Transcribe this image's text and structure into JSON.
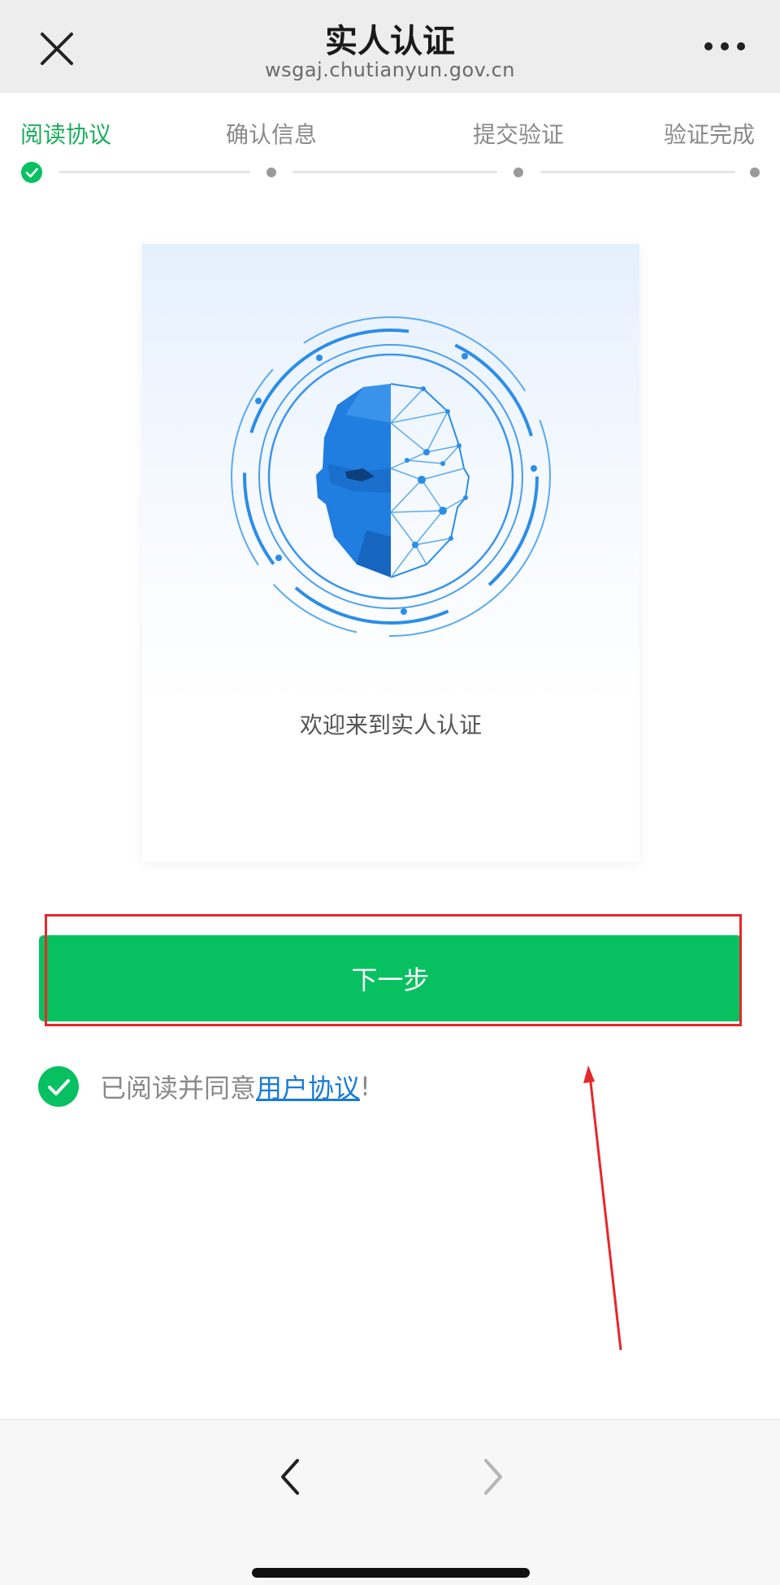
{
  "header": {
    "title": "实人认证",
    "domain": "wsgaj.chutianyun.gov.cn",
    "close_icon": "close-icon",
    "more_icon": "more-dots-icon"
  },
  "steps": [
    {
      "label": "阅读协议",
      "state": "done"
    },
    {
      "label": "确认信息",
      "state": "pending"
    },
    {
      "label": "提交验证",
      "state": "pending"
    },
    {
      "label": "验证完成",
      "state": "pending"
    }
  ],
  "card": {
    "illustration": "face-scan-illustration",
    "welcome": "欢迎来到实人认证"
  },
  "next_button": "下一步",
  "agreement": {
    "prefix": "已阅读并同意",
    "link": "用户协议",
    "suffix": "!",
    "checked": true
  },
  "colors": {
    "accent": "#07c160",
    "step_active": "#1aad5b",
    "link": "#1a7bd6",
    "annotation": "#e8262a"
  },
  "bottom_nav": {
    "back_icon": "chevron-left-icon",
    "forward_icon": "chevron-right-icon",
    "forward_enabled": false
  }
}
